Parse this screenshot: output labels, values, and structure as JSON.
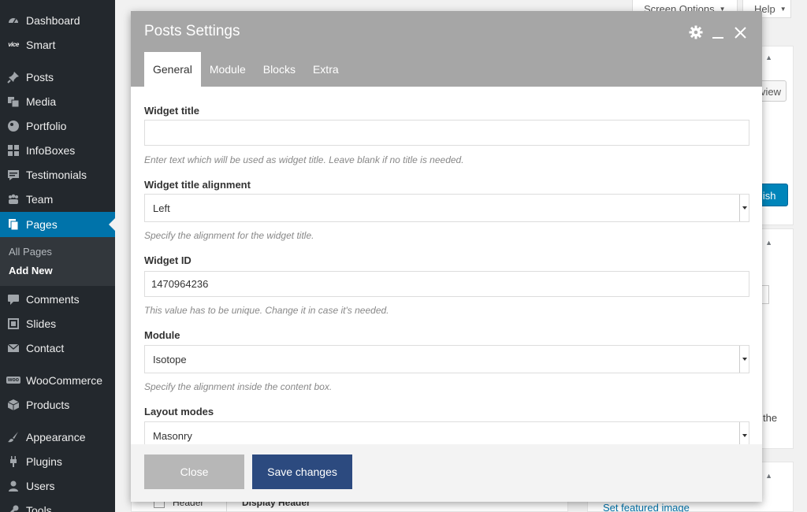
{
  "sidebar": {
    "items": [
      {
        "label": "Dashboard",
        "icon": "dashboard-icon"
      },
      {
        "label": "Smart",
        "icon": "smart-icon",
        "icon_text": "vice"
      },
      {
        "label": "Posts",
        "icon": "pin-icon"
      },
      {
        "label": "Media",
        "icon": "media-icon"
      },
      {
        "label": "Portfolio",
        "icon": "portfolio-icon"
      },
      {
        "label": "InfoBoxes",
        "icon": "grid-icon"
      },
      {
        "label": "Testimonials",
        "icon": "testimonials-icon"
      },
      {
        "label": "Team",
        "icon": "team-icon"
      },
      {
        "label": "Pages",
        "icon": "pages-icon"
      },
      {
        "label": "Comments",
        "icon": "comments-icon"
      },
      {
        "label": "Slides",
        "icon": "slides-icon"
      },
      {
        "label": "Contact",
        "icon": "mail-icon"
      },
      {
        "label": "WooCommerce",
        "icon": "woocommerce-icon",
        "icon_text": "woo"
      },
      {
        "label": "Products",
        "icon": "products-icon"
      },
      {
        "label": "Appearance",
        "icon": "appearance-icon"
      },
      {
        "label": "Plugins",
        "icon": "plugins-icon"
      },
      {
        "label": "Users",
        "icon": "users-icon"
      },
      {
        "label": "Tools",
        "icon": "tools-icon"
      }
    ],
    "active": "Pages",
    "submenu": [
      {
        "label": "All Pages"
      },
      {
        "label": "Add New"
      }
    ]
  },
  "background": {
    "screen_options": "Screen Options",
    "help": "Help",
    "preview_fragment": "view",
    "publish_fragment": "lish",
    "the_fragment": "the",
    "set_featured_image": "Set featured image",
    "row_header": "Header",
    "row_display_header": "Display Header"
  },
  "modal": {
    "title": "Posts Settings",
    "tabs": [
      {
        "label": "General"
      },
      {
        "label": "Module"
      },
      {
        "label": "Blocks"
      },
      {
        "label": "Extra"
      }
    ],
    "fields": {
      "widget_title": {
        "label": "Widget title",
        "value": "",
        "help": "Enter text which will be used as widget title. Leave blank if no title is needed."
      },
      "widget_title_alignment": {
        "label": "Widget title alignment",
        "value": "Left",
        "help": "Specify the alignment for the widget title."
      },
      "widget_id": {
        "label": "Widget ID",
        "value": "1470964236",
        "help": "This value has to be unique. Change it in case it's needed."
      },
      "module": {
        "label": "Module",
        "value": "Isotope",
        "help": "Specify the alignment inside the content box."
      },
      "layout_modes": {
        "label": "Layout modes",
        "value": "Masonry"
      }
    },
    "footer": {
      "close_label": "Close",
      "save_label": "Save changes"
    }
  },
  "colors": {
    "sidebar_bg": "#23282d",
    "active_menu": "#0073aa",
    "modal_header": "#a6a6a6",
    "save_button": "#2c4a7f",
    "close_button": "#b7b7b7"
  }
}
